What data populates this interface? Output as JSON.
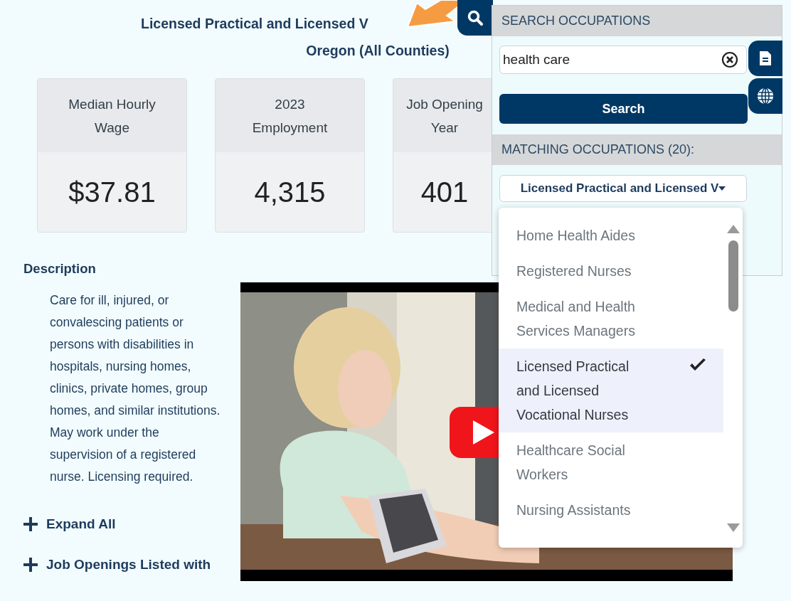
{
  "heading": {
    "lines": [
      "Licensed Practical and Licensed V",
      "Oregon (All Counties)"
    ]
  },
  "stats": [
    {
      "label_lines": [
        "Median Hourly",
        "Wage"
      ],
      "value": "$37.81"
    },
    {
      "label_lines": [
        "2023",
        "Employment"
      ],
      "value": "4,315"
    },
    {
      "label_lines": [
        "Job Opening",
        "Year"
      ],
      "value": "401"
    }
  ],
  "description": {
    "title": "Description",
    "text": "Care for ill, injured, or convalescing patients or persons with disabilities in hospitals, nursing homes, clinics, private homes, group homes, and similar institutions. May work under the supervision of a registered nurse. Licensing required."
  },
  "sections": [
    {
      "label": "Expand All",
      "expanded": false
    },
    {
      "label": "Job Openings Listed with",
      "expanded": false
    }
  ],
  "search_panel": {
    "title": "SEARCH OCCUPATIONS",
    "query": "health care",
    "button": "Search",
    "results_title": "MATCHING OCCUPATIONS (20):",
    "selected_value": "Licensed Practical and Licensed V",
    "options": [
      {
        "label": "Home Health Aides",
        "selected": false
      },
      {
        "label": "Registered Nurses",
        "selected": false
      },
      {
        "label": "Medical and Health Services Managers",
        "selected": false
      },
      {
        "label": "Licensed Practical and Licensed Vocational Nurses",
        "selected": true
      },
      {
        "label": "Healthcare Social Workers",
        "selected": false
      },
      {
        "label": "Nursing Assistants",
        "selected": false
      }
    ]
  }
}
